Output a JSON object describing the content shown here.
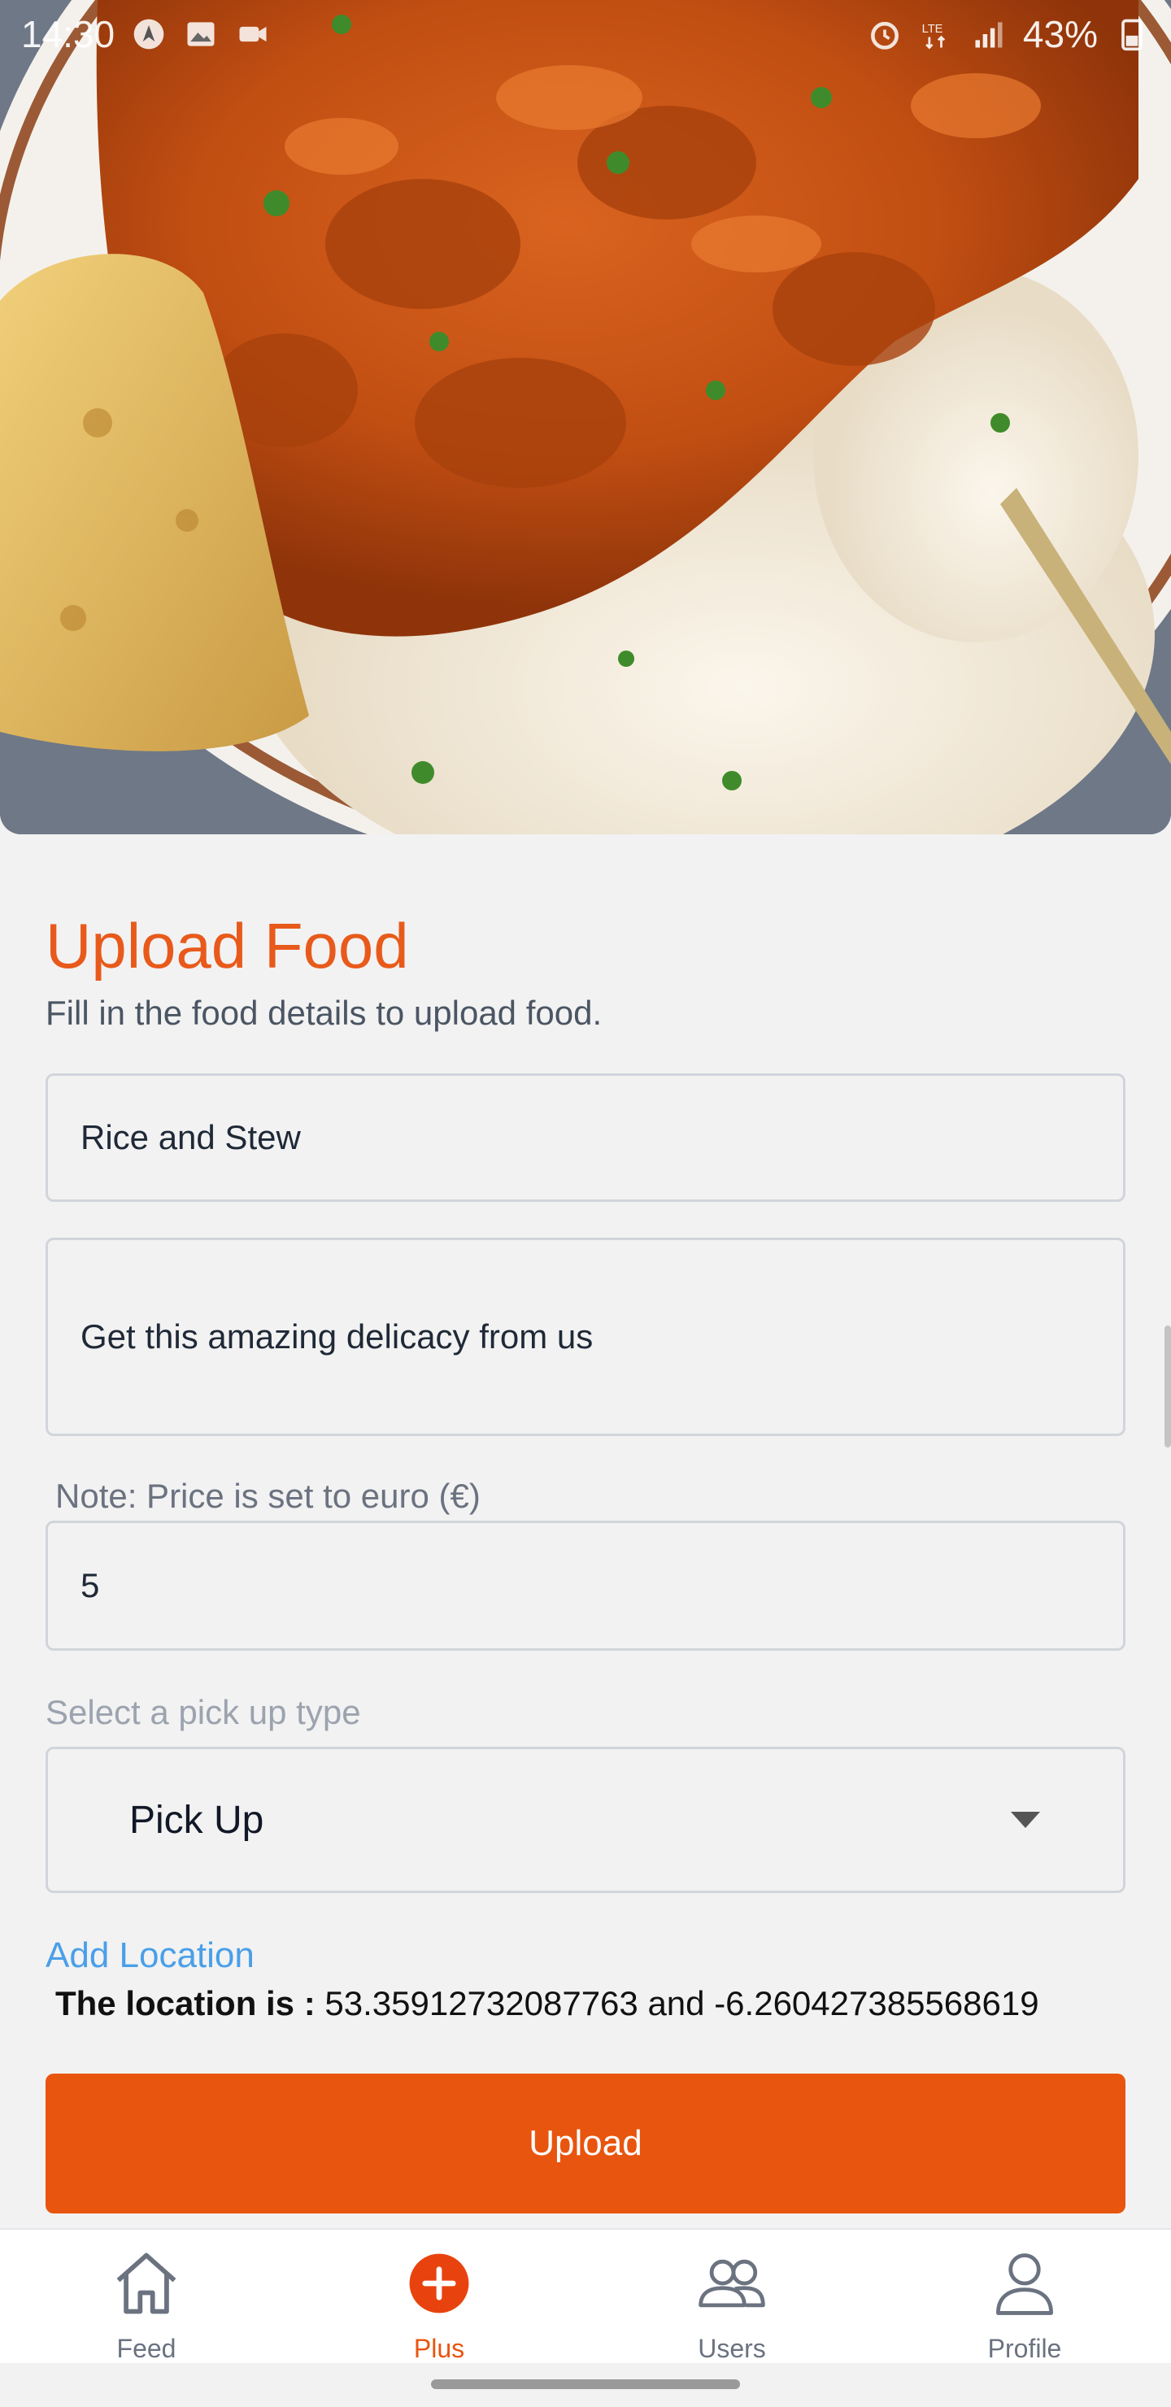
{
  "status_bar": {
    "time": "14:30",
    "battery": "43%",
    "network": "LTE"
  },
  "form": {
    "title": "Upload Food",
    "subtitle": "Fill in the food details to upload food.",
    "name_value": "Rice and Stew",
    "description_value": "Get this amazing delicacy from us",
    "price_note": "Note: Price is set to euro (€)",
    "price_value": "5",
    "pickup_label": "Select a pick up type",
    "pickup_selected": "Pick Up",
    "add_location_label": "Add Location",
    "location_prefix": "The location is :",
    "location_value": "53.35912732087763 and -6.260427385568619",
    "upload_label": "Upload"
  },
  "bottom_nav": {
    "items": [
      {
        "label": "Feed",
        "icon": "home-icon",
        "active": false
      },
      {
        "label": "Plus",
        "icon": "plus-circle-icon",
        "active": true
      },
      {
        "label": "Users",
        "icon": "users-icon",
        "active": false
      },
      {
        "label": "Profile",
        "icon": "profile-icon",
        "active": false
      }
    ]
  },
  "colors": {
    "accent": "#e8550e",
    "title": "#e85a1b",
    "link": "#4a9fe8",
    "background": "#f2f2f2"
  }
}
